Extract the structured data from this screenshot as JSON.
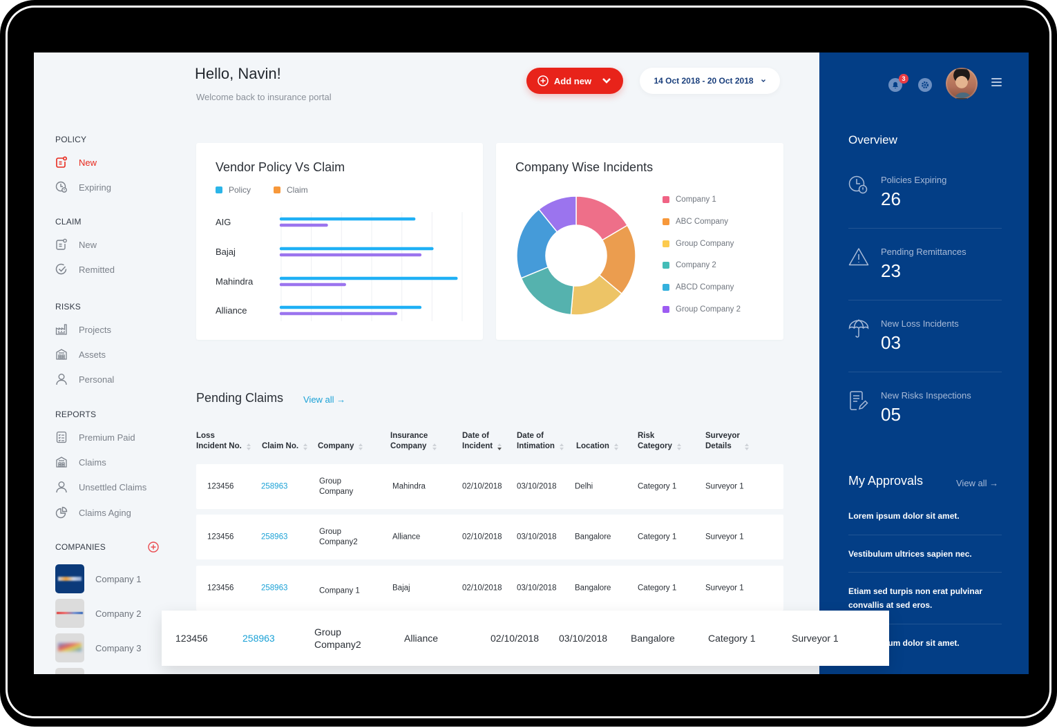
{
  "header": {
    "greeting": "Hello, Navin!",
    "subtitle": "Welcome back to insurance portal",
    "add_new_label": "Add new",
    "date_range": "14 Oct 2018 - 20 Oct 2018"
  },
  "leftnav": {
    "sections": [
      {
        "title": "POLICY",
        "items": [
          {
            "label": "New",
            "icon": "new-document-icon",
            "active": true
          },
          {
            "label": "Expiring",
            "icon": "clock-alert-icon"
          }
        ]
      },
      {
        "title": "CLAIM",
        "items": [
          {
            "label": "New",
            "icon": "new-document-icon"
          },
          {
            "label": "Remitted",
            "icon": "check-circle-icon"
          }
        ]
      },
      {
        "title": "RISKS",
        "items": [
          {
            "label": "Projects",
            "icon": "factory-icon"
          },
          {
            "label": "Assets",
            "icon": "warehouse-icon"
          },
          {
            "label": "Personal",
            "icon": "user-icon"
          }
        ]
      },
      {
        "title": "REPORTS",
        "items": [
          {
            "label": "Premium Paid",
            "icon": "checklist-icon"
          },
          {
            "label": "Claims",
            "icon": "warehouse-icon"
          },
          {
            "label": "Unsettled Claims",
            "icon": "user-icon"
          },
          {
            "label": "Claims Aging",
            "icon": "pie-chart-icon"
          }
        ]
      }
    ],
    "companies_title": "COMPANIES",
    "companies": [
      {
        "label": "Company 1"
      },
      {
        "label": "Company 2"
      },
      {
        "label": "Company 3"
      }
    ]
  },
  "vendor_chart_title": "Vendor Policy Vs Claim",
  "incidents_chart_title": "Company Wise Incidents",
  "chart_data": [
    {
      "type": "bar",
      "orientation": "horizontal",
      "title": "Vendor Policy Vs Claim",
      "categories": [
        "AIG",
        "Bajaj",
        "Mahindra",
        "Alliance"
      ],
      "series": [
        {
          "name": "Policy",
          "legend_color": "#2bb5e8",
          "bar_color": "#1fb0f5",
          "values": [
            44,
            50,
            58,
            46
          ]
        },
        {
          "name": "Claim",
          "legend_color": "#f7983a",
          "bar_color": "#9b74ee",
          "values": [
            15,
            46,
            21,
            38
          ]
        }
      ],
      "xlim": [
        0,
        60
      ],
      "grid": true,
      "gridlines": 7,
      "legend": "top-left",
      "xlabel": "",
      "ylabel": ""
    },
    {
      "type": "pie",
      "variant": "donut",
      "title": "Company Wise Incidents",
      "labels": [
        "Company 1",
        "ABC Company",
        "Group Company",
        "Company 2",
        "ABCD Company",
        "Group Company 2"
      ],
      "values": [
        16.5,
        19.6,
        15.3,
        17.4,
        20.4,
        10.8
      ],
      "slice_colors": [
        "#ee6f89",
        "#eb9d4f",
        "#edc466",
        "#55b2ae",
        "#459bd9",
        "#9b74ee"
      ],
      "legend_colors": [
        "#f06384",
        "#f7983a",
        "#fccb4f",
        "#44bdb8",
        "#35b1dd",
        "#9d5cf2"
      ],
      "legend": "right"
    }
  ],
  "pending_claims": {
    "title": "Pending Claims",
    "view_all": "View all →",
    "columns": [
      {
        "line1": "Loss",
        "line2": "Incident No."
      },
      {
        "line1": "",
        "line2": "Claim No."
      },
      {
        "line1": "",
        "line2": "Company"
      },
      {
        "line1": "Insurance",
        "line2": "Company"
      },
      {
        "line1": "Date of",
        "line2": "Incident",
        "sorted": "desc"
      },
      {
        "line1": "Date of",
        "line2": "Intimation"
      },
      {
        "line1": "",
        "line2": "Location"
      },
      {
        "line1": "Risk",
        "line2": "Category"
      },
      {
        "line1": "Surveyor",
        "line2": "Details"
      }
    ],
    "rows": [
      {
        "loss_no": "123456",
        "claim_no": "258963",
        "company": "Group\nCompany",
        "insurer": "Mahindra",
        "date_incident": "02/10/2018",
        "date_intimation": "03/10/2018",
        "location": "Delhi",
        "risk": "Category 1",
        "surveyor": "Surveyor 1"
      },
      {
        "loss_no": "123456",
        "claim_no": "258963",
        "company": "Group\nCompany2",
        "insurer": "Alliance",
        "date_incident": "02/10/2018",
        "date_intimation": "03/10/2018",
        "location": "Bangalore",
        "risk": "Category 1",
        "surveyor": "Surveyor 1"
      },
      {
        "loss_no": "123456",
        "claim_no": "258963",
        "company": "Company 1",
        "insurer": "Bajaj",
        "date_incident": "02/10/2018",
        "date_intimation": "03/10/2018",
        "location": "Bangalore",
        "risk": "Category 1",
        "surveyor": "Surveyor 1"
      },
      {
        "loss_no": "123456",
        "claim_no": "258963",
        "company": "Group\nCompany2",
        "insurer": "Alliance",
        "date_incident": "02/10/2018",
        "date_intimation": "03/10/2018",
        "location": "Bangalore",
        "risk": "Category 1",
        "surveyor": "Surveyor 1",
        "hovered": true
      }
    ]
  },
  "rightpanel": {
    "notification_count": "3",
    "overview_title": "Overview",
    "overview": [
      {
        "label": "Policies Expiring",
        "value": "26",
        "icon": "clock-alert-icon"
      },
      {
        "label": "Pending Remittances",
        "value": "23",
        "icon": "warning-icon"
      },
      {
        "label": "New Loss Incidents",
        "value": "03",
        "icon": "umbrella-icon"
      },
      {
        "label": "New Risks Inspections",
        "value": "05",
        "icon": "edit-document-icon"
      }
    ],
    "approvals_title": "My Approvals",
    "approvals_view_all": "View all →",
    "approvals": [
      "Lorem ipsum dolor sit amet.",
      "Vestibulum ultrices sapien nec.",
      "Etiam sed turpis non erat pulvinar convallis at sed eros.",
      "Lorem ipsum dolor sit amet."
    ]
  },
  "colors": {
    "accent_red": "#e8231a",
    "panel_blue": "#033e86",
    "link_blue": "#1aa1d6",
    "background": "#f3f6f9"
  }
}
